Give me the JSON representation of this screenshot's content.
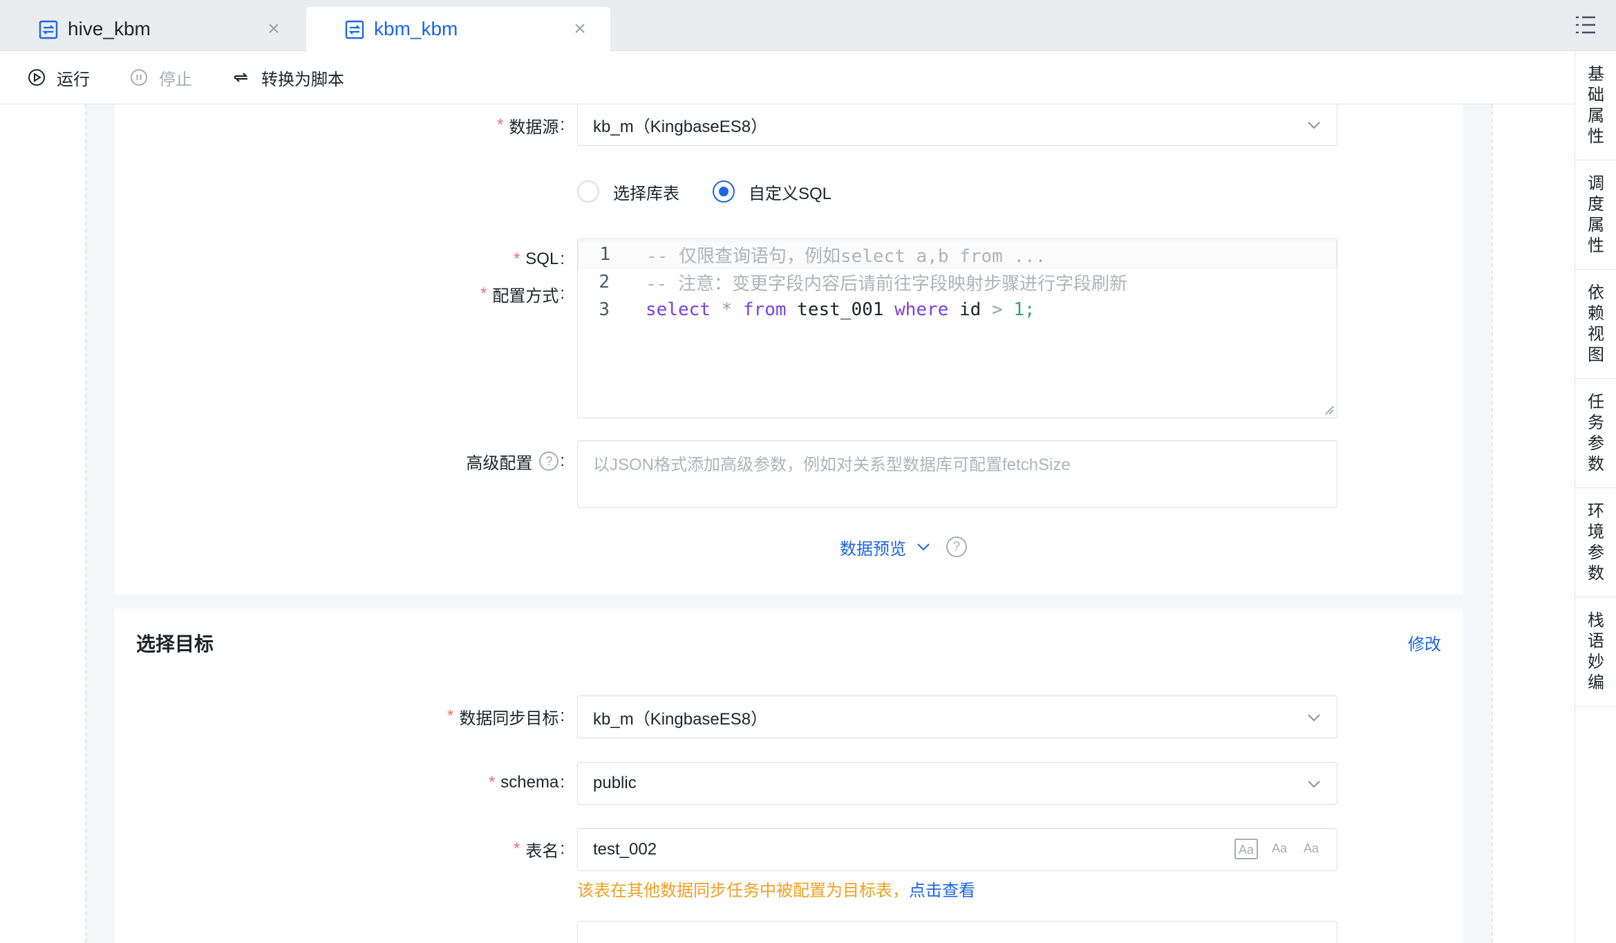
{
  "tabs": [
    {
      "label": "hive_kbm",
      "active": false
    },
    {
      "label": "kbm_kbm",
      "active": true
    }
  ],
  "toolbar": {
    "run_label": "运行",
    "stop_label": "停止",
    "convert_label": "转换为脚本"
  },
  "right_sidebar": [
    {
      "label": "基础属性",
      "chars": [
        "基",
        "础",
        "属",
        "性"
      ]
    },
    {
      "label": "调度属性",
      "chars": [
        "调",
        "度",
        "属",
        "性"
      ]
    },
    {
      "label": "依赖视图",
      "chars": [
        "依",
        "赖",
        "视",
        "图"
      ]
    },
    {
      "label": "任务参数",
      "chars": [
        "任",
        "务",
        "参",
        "数"
      ]
    },
    {
      "label": "环境参数",
      "chars": [
        "环",
        "境",
        "参",
        "数"
      ]
    },
    {
      "label": "栈语妙编",
      "chars": [
        "栈",
        "语",
        "妙",
        "编"
      ]
    }
  ],
  "source": {
    "datasource_label": "数据源",
    "datasource_value": "kb_m（KingbaseES8）",
    "config_mode_label": "配置方式",
    "config_modes": [
      {
        "label": "选择库表",
        "checked": false
      },
      {
        "label": "自定义SQL",
        "checked": true
      }
    ],
    "sql_label": "SQL",
    "sql_lines": [
      {
        "num": "1",
        "text": "-- 仅限查询语句，例如select a,b from ..."
      },
      {
        "num": "2",
        "text": "-- 注意：变更字段内容后请前往字段映射步骤进行字段刷新"
      },
      {
        "num": "3",
        "tokens": [
          "select",
          "*",
          "from",
          "test_001",
          "where",
          "id",
          ">",
          "1;"
        ]
      }
    ],
    "advanced_label": "高级配置",
    "advanced_placeholder": "以JSON格式添加高级参数，例如对关系型数据库可配置fetchSize",
    "preview_label": "数据预览",
    "help_symbol": "?"
  },
  "target": {
    "title": "选择目标",
    "edit_link": "修改",
    "sync_target_label": "数据同步目标",
    "sync_target_value": "kb_m（KingbaseES8）",
    "schema_label": "schema",
    "schema_value": "public",
    "table_label": "表名",
    "table_value": "test_002",
    "case_icons": [
      "Aa",
      "Aa",
      "Aa"
    ],
    "warning_text": "该表在其他数据同步任务中被配置为目标表，",
    "warning_link": "点击查看"
  },
  "form": {
    "colon": ":",
    "required_mark": "*"
  },
  "colors": {
    "accent": "#1a66e6",
    "required": "#f56c6c",
    "warning": "#f0a020"
  }
}
